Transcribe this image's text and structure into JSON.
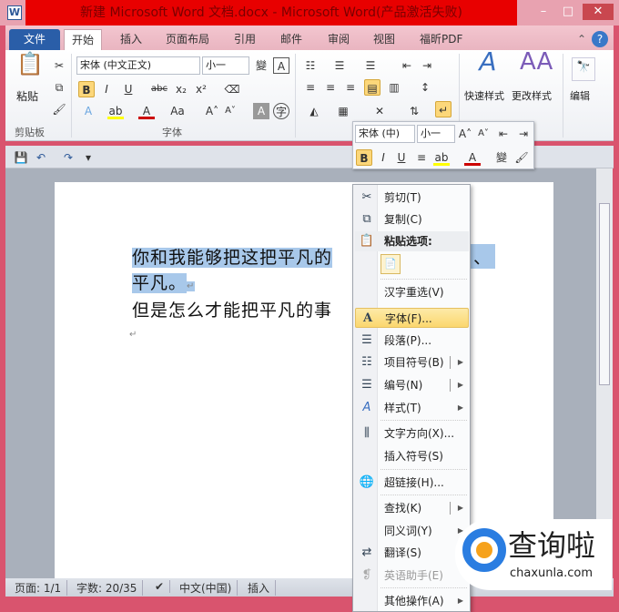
{
  "window": {
    "title": "新建 Microsoft Word 文档.docx - Microsoft Word(产品激活失败)",
    "app_icon": "W",
    "minimize": "–",
    "maximize": "□",
    "close": "✕"
  },
  "tabs": [
    "文件",
    "开始",
    "插入",
    "页面布局",
    "引用",
    "邮件",
    "审阅",
    "视图",
    "福昕PDF"
  ],
  "ribbon": {
    "clipboard": {
      "label": "剪贴板",
      "paste": "粘贴"
    },
    "font": {
      "label": "字体",
      "font_name": "宋体 (中文正文)",
      "font_size": "小一"
    },
    "styles": {
      "quick": "快速样式",
      "change": "更改样式"
    },
    "editing": {
      "label": "编辑"
    }
  },
  "mini_toolbar": {
    "font_name": "宋体 (中)",
    "font_size": "小一"
  },
  "document": {
    "line1": "你和我能够把这把平凡的",
    "line1_tail": "、",
    "line2": "平凡。",
    "line3": "但是怎么才能把平凡的事"
  },
  "context_menu": [
    {
      "label": "剪切(T)",
      "icon": "scissors-icon",
      "glyph": "✂"
    },
    {
      "label": "复制(C)",
      "icon": "copy-icon",
      "glyph": "⧉"
    },
    {
      "label": "粘贴选项:",
      "icon": "paste-icon",
      "glyph": "📋"
    },
    {
      "label": "汉字重选(V)"
    },
    {
      "label": "字体(F)...",
      "icon": "font-icon",
      "glyph": "A"
    },
    {
      "label": "段落(P)...",
      "icon": "paragraph-icon",
      "glyph": "☰"
    },
    {
      "label": "项目符号(B)",
      "icon": "bullets-icon",
      "glyph": "☷"
    },
    {
      "label": "编号(N)",
      "icon": "numbering-icon",
      "glyph": "☰"
    },
    {
      "label": "样式(T)",
      "icon": "styles-icon",
      "glyph": "A"
    },
    {
      "label": "文字方向(X)...",
      "icon": "text-direction-icon",
      "glyph": "⫼"
    },
    {
      "label": "插入符号(S)"
    },
    {
      "label": "超链接(H)...",
      "icon": "hyperlink-icon",
      "glyph": "🌐"
    },
    {
      "label": "查找(K)"
    },
    {
      "label": "同义词(Y)"
    },
    {
      "label": "翻译(S)",
      "icon": "translate-icon",
      "glyph": "⇄"
    },
    {
      "label": "英语助手(E)",
      "icon": "english-assistant-icon",
      "glyph": "❡"
    },
    {
      "label": "其他操作(A)"
    }
  ],
  "status": {
    "page": "页面: 1/1",
    "words": "字数: 20/35",
    "language": "中文(中国)",
    "mode": "插入"
  },
  "watermark": {
    "name": "查询啦",
    "url": "chaxunla.com"
  }
}
